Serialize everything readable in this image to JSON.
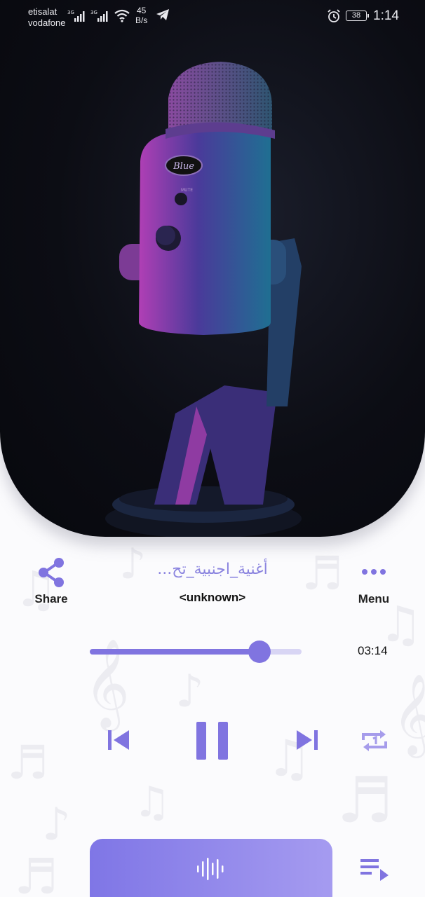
{
  "status_bar": {
    "carrier_1": "etisalat",
    "carrier_2": "vodafone",
    "network_1": "3G",
    "network_2": "3G",
    "net_speed_value": "45",
    "net_speed_unit": "B/s",
    "battery": "38",
    "time": "1:14"
  },
  "artwork": {
    "mic_brand": "Blue",
    "mute_label": "MUTE"
  },
  "track": {
    "title": "أغنية_اجنبية_تح...",
    "artist": "<unknown>",
    "duration": "03:14",
    "progress": 0.8
  },
  "actions": {
    "share_label": "Share",
    "menu_label": "Menu"
  },
  "icons": {
    "share": "share-icon",
    "menu": "more-horizontal-icon",
    "previous": "skip-previous-icon",
    "pause": "pause-icon",
    "next": "skip-next-icon",
    "repeat": "repeat-one-icon",
    "waveform": "waveform-icon",
    "queue": "playlist-play-icon"
  },
  "colors": {
    "accent": "#8074e0",
    "accent_light": "#d8d5f4",
    "title": "#8b84df"
  }
}
